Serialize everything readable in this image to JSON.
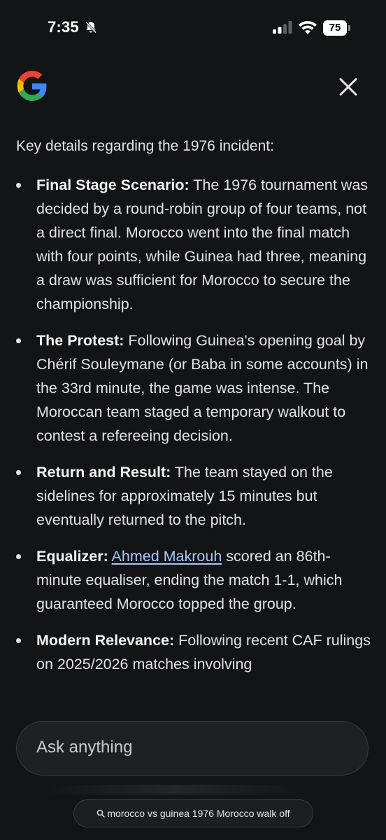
{
  "status_bar": {
    "time": "7:35",
    "battery": "75"
  },
  "header": {
    "logo": "google-g-icon",
    "close_icon": "close-icon"
  },
  "content": {
    "intro": "Key details regarding the 1976 incident:",
    "items": [
      {
        "term": "Final Stage Scenario:",
        "text": " The 1976 tournament was decided by a round-robin group of four teams, not a direct final. Morocco went into the final match with four points, while Guinea had three, meaning a draw was sufficient for Morocco to secure the championship."
      },
      {
        "term": "The Protest:",
        "text": " Following Guinea's opening goal by Chérif Souleymane (or Baba in some accounts) in the 33rd minute, the game was intense. The Moroccan team staged a temporary walkout to contest a refereeing decision."
      },
      {
        "term": "Return and Result:",
        "text": " The team stayed on the sidelines for approximately 15 minutes but eventually returned to the pitch."
      },
      {
        "term": "Equalizer:",
        "link": "Ahmed Makrouh",
        "text": " scored an 86th-minute equaliser, ending the match 1-1, which guaranteed Morocco topped the group."
      },
      {
        "term": "Modern Relevance:",
        "text": " Following recent CAF rulings on 2025/2026 matches involving"
      }
    ]
  },
  "ask": {
    "placeholder": "Ask anything"
  },
  "query_chip": {
    "text": "morocco vs guinea 1976 Morocco walk off",
    "icon": "search-icon"
  },
  "colors": {
    "background": "#131416",
    "text": "#e3e3e3",
    "link": "#a8c7fa"
  }
}
